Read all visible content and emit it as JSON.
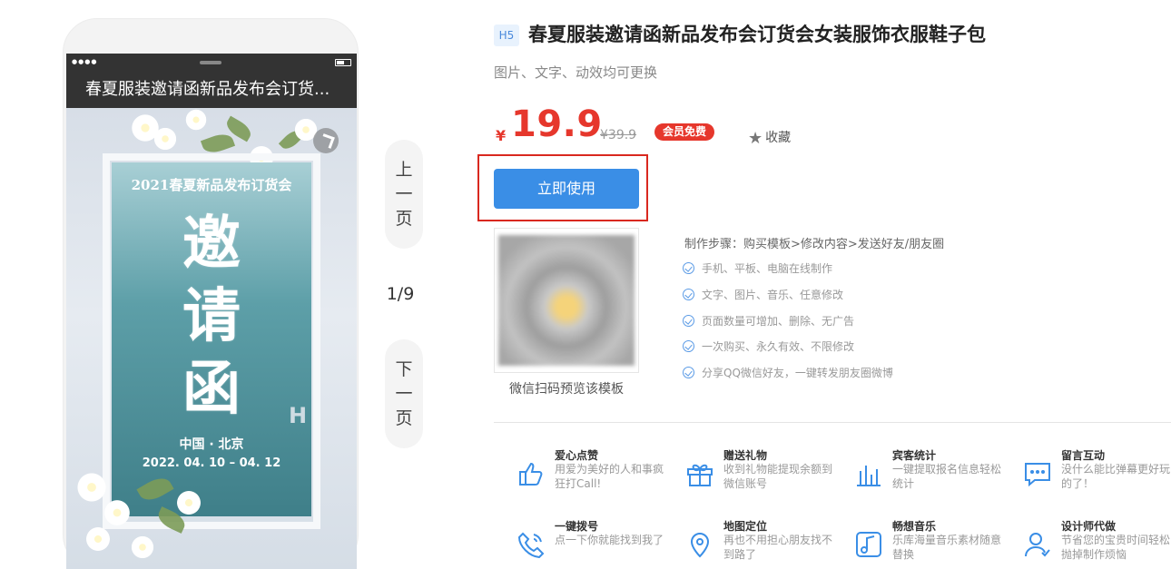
{
  "preview": {
    "phone_title": "春夏服装邀请函新品发布会订货...",
    "poster": {
      "top_line": "2021春夏新品发布订货会",
      "big_char_1": "邀",
      "big_char_2": "请",
      "big_char_3": "函",
      "place": "中国 · 北京",
      "date": "2022. 04. 10 – 04. 12"
    }
  },
  "pager": {
    "prev": [
      "上",
      "一",
      "页"
    ],
    "next": [
      "下",
      "一",
      "页"
    ],
    "indicator": "1/9"
  },
  "product": {
    "badge": "H5",
    "title": "春夏服装邀请函新品发布会订货会女装服饰衣服鞋子包",
    "subtitle": "图片、文字、动效均可更换",
    "currency": "¥",
    "price": "19.9",
    "old_price": "¥39.9",
    "vip_label": "会员免费",
    "favorite_label": "收藏",
    "use_button": "立即使用",
    "qr_caption": "微信扫码预览该模板",
    "steps": "制作步骤：购买模板>修改内容>发送好友/朋友圈",
    "features": [
      "手机、平板、电脑在线制作",
      "文字、图片、音乐、任意修改",
      "页面数量可增加、删除、无广告",
      "一次购买、永久有效、不限修改",
      "分享QQ微信好友，一键转发朋友圈微博"
    ]
  },
  "functions": [
    {
      "title": "爱心点赞",
      "desc": "用爱为美好的人和事疯狂打Call!",
      "icon": "thumbs-up-icon"
    },
    {
      "title": "赠送礼物",
      "desc": "收到礼物能提现余额到微信账号",
      "icon": "gift-icon"
    },
    {
      "title": "宾客统计",
      "desc": "一键提取报名信息轻松统计",
      "icon": "bar-chart-icon"
    },
    {
      "title": "留言互动",
      "desc": "没什么能比弹幕更好玩的了！",
      "icon": "chat-icon"
    },
    {
      "title": "一键拨号",
      "desc": "点一下你就能找到我了",
      "icon": "phone-icon"
    },
    {
      "title": "地图定位",
      "desc": "再也不用担心朋友找不到路了",
      "icon": "map-pin-icon"
    },
    {
      "title": "畅想音乐",
      "desc": "乐库海量音乐素材随意替换",
      "icon": "music-icon"
    },
    {
      "title": "设计师代做",
      "desc": "节省您的宝贵时间轻松抛掉制作烦恼",
      "icon": "designer-icon"
    }
  ],
  "colors": {
    "accent": "#3a8ee6",
    "price_red": "#e6372c",
    "highlight_outline": "#d9281f"
  }
}
